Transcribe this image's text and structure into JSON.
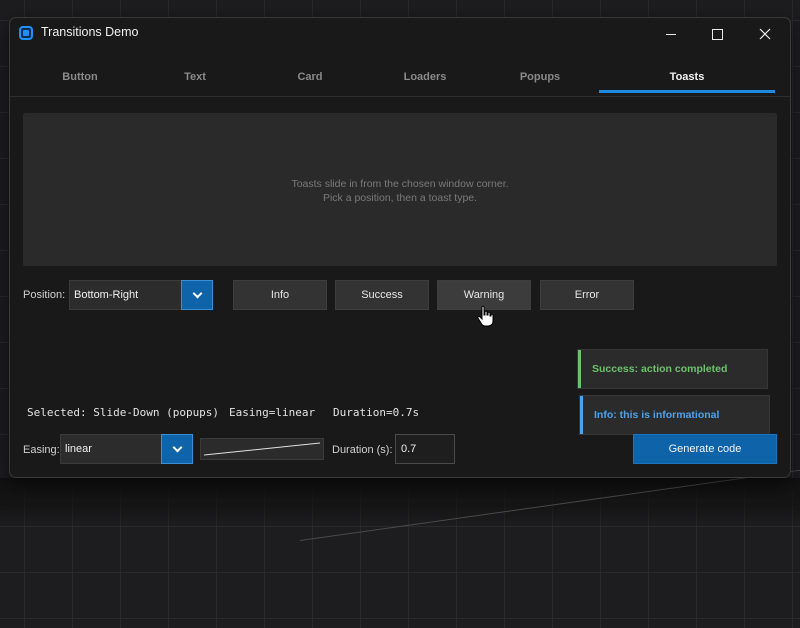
{
  "window": {
    "title": "Transitions Demo"
  },
  "tabs": [
    {
      "label": "Button"
    },
    {
      "label": "Text"
    },
    {
      "label": "Card"
    },
    {
      "label": "Loaders"
    },
    {
      "label": "Popups"
    },
    {
      "label": "Toasts",
      "active": true
    }
  ],
  "preview": {
    "hint_line1": "Toasts slide in from the chosen window corner.",
    "hint_line2": "Pick a position, then a toast type."
  },
  "position": {
    "label": "Position:",
    "value": "Bottom-Right"
  },
  "toast_buttons": {
    "info": "Info",
    "success": "Success",
    "warning": "Warning",
    "error": "Error"
  },
  "toasts": [
    {
      "text": "Success: action completed",
      "color": "#6cc36c"
    },
    {
      "text": "Info: this is informational",
      "color": "#4aa3f0"
    }
  ],
  "status": {
    "selected": "Selected: Slide-Down (popups)",
    "easing": "Easing=linear",
    "duration": "Duration=0.7s"
  },
  "easing": {
    "label": "Easing:",
    "value": "linear"
  },
  "duration": {
    "label": "Duration (s):",
    "value": "0.7"
  },
  "generate_button": "Generate code",
  "colors": {
    "accent": "#0f63a8",
    "tab_underline": "#1f8be0",
    "success": "#6cc36c",
    "info": "#4aa3f0"
  }
}
